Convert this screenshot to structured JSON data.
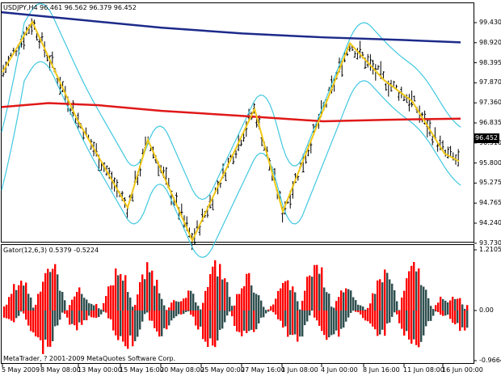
{
  "main_chart": {
    "title": "USDJPY,H4  96.461 96.562 96.379 96.452",
    "price_labels": [
      "99.430",
      "98.920",
      "98.395",
      "97.870",
      "97.360",
      "96.835",
      "96.310",
      "95.800",
      "95.275",
      "94.765",
      "94.240",
      "93.730"
    ],
    "current_price": "96.452",
    "colors": {
      "bars": "#000000",
      "bollinger": "#40c8e0",
      "zigzag": "#f0c818",
      "ma_slow": "#1c2a8a",
      "ma_mid": "#e01818"
    }
  },
  "indicator": {
    "title": "Gator(12,6,3) 0.5379 -0.5224",
    "scale_labels": [
      "1.2105",
      "0.00",
      "-0.9664"
    ],
    "colors": {
      "up": "#ff0000",
      "down": "#2f4f4f"
    }
  },
  "copyright": "MetaTrader, ? 2001-2009 MetaQuotes Software Corp.",
  "time_labels": [
    "5 May 2009",
    "8 May 08:00",
    "13 May 00:00",
    "15 May 16:00",
    "20 May 08:00",
    "25 May 00:00",
    "27 May 16:00",
    "1 Jun 08:00",
    "4 Jun 00:00",
    "8 Jun 16:00",
    "11 Jun 08:00",
    "16 Jun 00:00"
  ]
}
